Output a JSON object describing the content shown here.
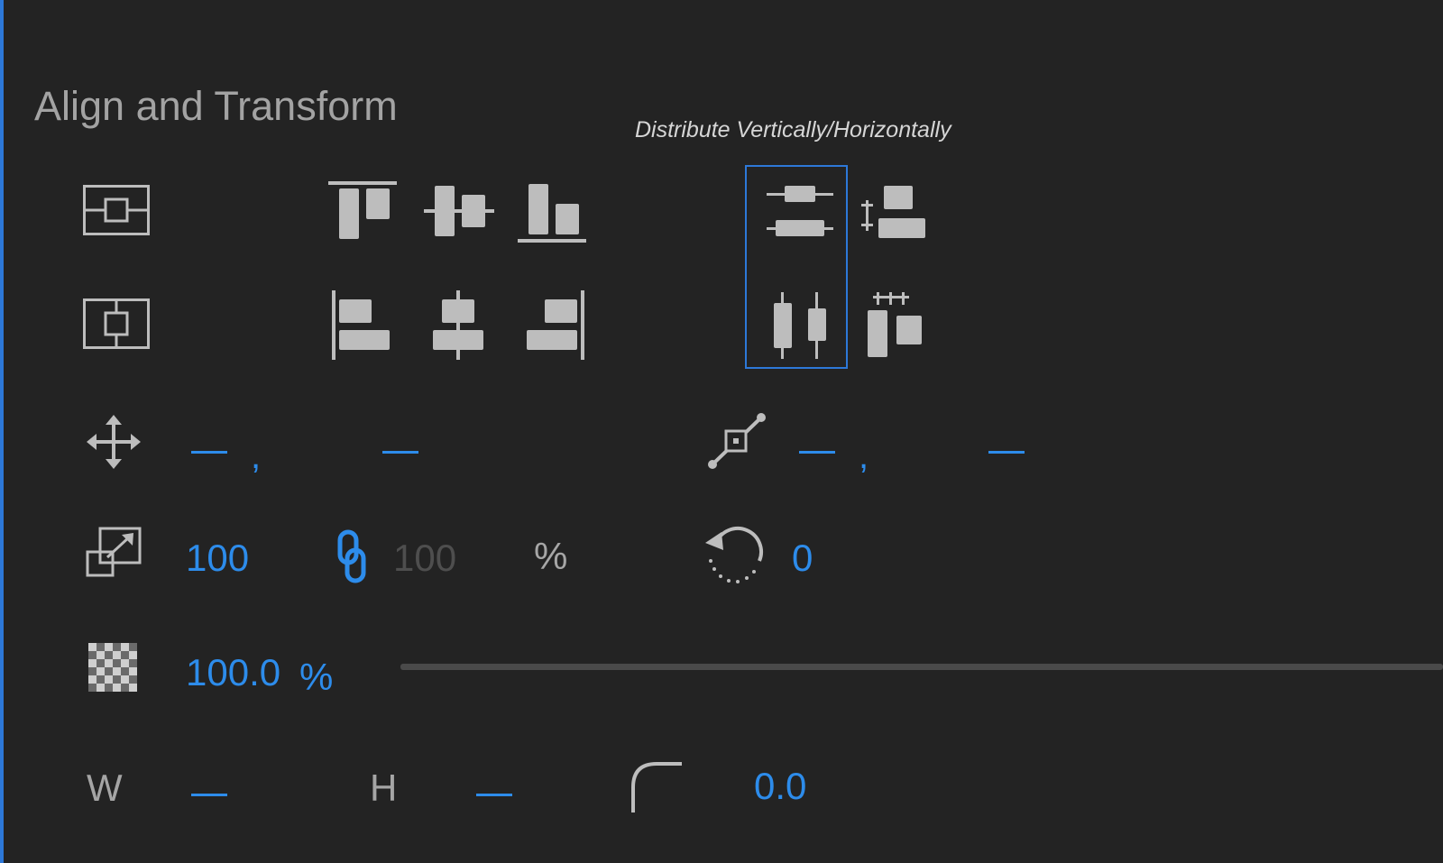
{
  "panel": {
    "title": "Align and Transform",
    "tooltip": "Distribute Vertically/Horizontally"
  },
  "icons": {
    "align_to_frame_vertical": "frame-center-horizontal-icon",
    "align_to_frame_horizontal": "frame-center-vertical-icon",
    "align_top": "align-top-icon",
    "align_vertical_center": "align-vertical-center-icon",
    "align_bottom": "align-bottom-icon",
    "align_left": "align-left-icon",
    "align_horizontal_center": "align-horizontal-center-icon",
    "align_right": "align-right-icon",
    "distribute_vertical": "distribute-vertical-icon",
    "distribute_vertical_spacing": "distribute-vertical-spacing-icon",
    "distribute_horizontal": "distribute-horizontal-icon",
    "distribute_horizontal_spacing": "distribute-horizontal-spacing-icon",
    "position": "move-icon",
    "anchor": "anchor-point-icon",
    "scale": "scale-icon",
    "link": "link-icon",
    "rotation": "rotation-icon",
    "opacity": "opacity-checker-icon",
    "corner_radius": "corner-radius-icon"
  },
  "transform": {
    "position_separator": ",",
    "anchor_separator": ",",
    "scale_width": "100",
    "scale_height": "100",
    "scale_unit": "%",
    "rotation": "0",
    "opacity": "100.0",
    "opacity_unit": "%",
    "opacity_fraction": 1.0,
    "width_label": "W",
    "height_label": "H",
    "corner_radius": "0.0"
  },
  "colors": {
    "background": "#232323",
    "accent": "#2d78d8",
    "value": "#2d8ceb",
    "icon": "#bdbdbd",
    "disabled_value": "#4e4e4e"
  }
}
